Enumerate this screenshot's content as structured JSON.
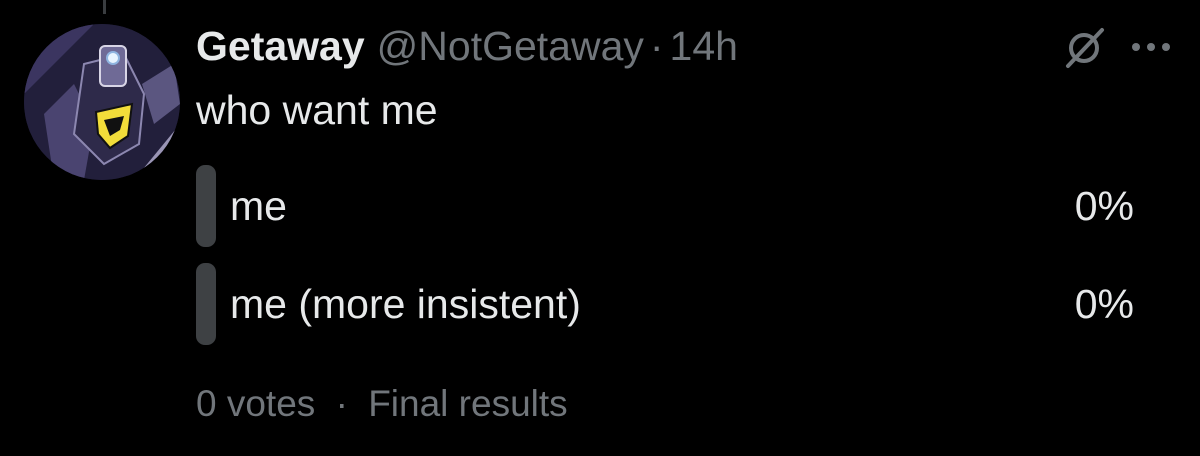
{
  "colors": {
    "background": "#000000",
    "primary_text": "#e7e9ea",
    "secondary_text": "#71767b",
    "poll_bar": "#3e4144"
  },
  "tweet": {
    "author": {
      "display_name": "Getaway",
      "handle": "@NotGetaway",
      "avatar_icon": "robot-avatar"
    },
    "separator": "·",
    "time": "14h",
    "text": "who want me",
    "header_icons": [
      "grok-icon",
      "more-icon"
    ]
  },
  "poll": {
    "options": [
      {
        "label": "me",
        "percent_text": "0%",
        "percent": 0
      },
      {
        "label": "me (more insistent)",
        "percent_text": "0%",
        "percent": 0
      }
    ],
    "votes": "0 votes",
    "footer_separator": "·",
    "status": "Final results"
  }
}
